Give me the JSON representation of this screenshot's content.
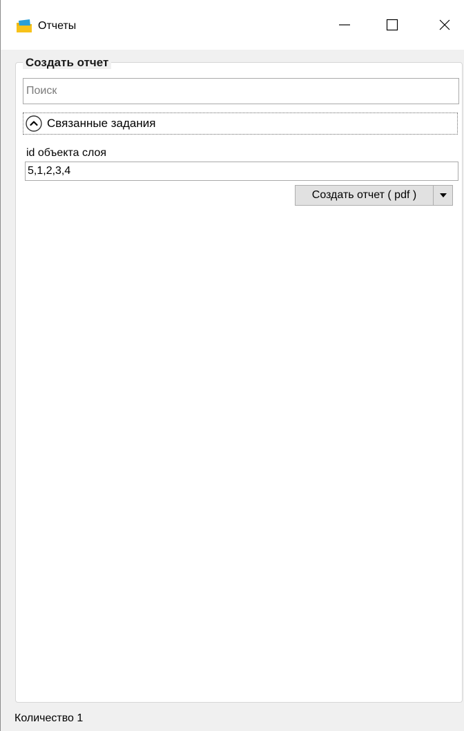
{
  "window": {
    "title": "Отчеты",
    "icon": "app-folder-icon",
    "controls": {
      "minimize": "minimize-icon",
      "maximize": "maximize-icon",
      "close": "close-icon"
    }
  },
  "group": {
    "title": "Создать отчет",
    "search": {
      "placeholder": "Поиск",
      "value": ""
    },
    "expander": {
      "label": "Связанные задания",
      "state": "expanded"
    },
    "field": {
      "label": "id объекта слоя",
      "value": "5,1,2,3,4"
    },
    "create_button": {
      "label": "Создать отчет ( pdf )",
      "dropdown_icon": "caret-down-icon"
    }
  },
  "status": {
    "text": "Количество 1"
  },
  "colors": {
    "window_bg": "#f0f0f0",
    "panel_bg": "#ffffff",
    "button_bg": "#e1e1e1",
    "border": "#a9a9a9"
  }
}
